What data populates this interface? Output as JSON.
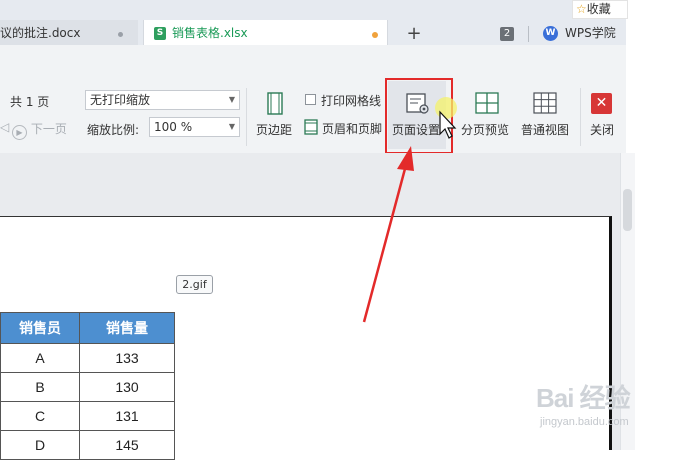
{
  "tabs": [
    {
      "label": "议的批注.docx",
      "type": "docx"
    },
    {
      "label": "销售表格.xlsx",
      "type": "xlsx",
      "active": true
    }
  ],
  "tabbar": {
    "new_tab_glyph": "+",
    "tab_count": "2",
    "wps_logo": "W",
    "wps_label": "WPS学院",
    "favorite_label": "收藏"
  },
  "ribbon": {
    "total_pages": "共 1 页",
    "next_page": "下一页",
    "scale_mode": "无打印缩放",
    "zoom_label": "缩放比例:",
    "zoom_value": "100 %",
    "print_gridlines": "打印网格线",
    "margins": "页边距",
    "header_footer": "页眉和页脚",
    "page_setup": "页面设置",
    "page_break_preview": "分页预览",
    "normal_view": "普通视图",
    "close": "关闭"
  },
  "preview": {
    "image_label": "2.gif",
    "table": {
      "headers": [
        "销售员",
        "销售量"
      ],
      "rows": [
        [
          "A",
          "133"
        ],
        [
          "B",
          "130"
        ],
        [
          "C",
          "131"
        ],
        [
          "D",
          "145"
        ]
      ]
    }
  },
  "watermark": {
    "brand": "Bai  经验",
    "url": "jingyan.baidu.com"
  },
  "colors": {
    "accent_green": "#1a9a57",
    "highlight_red": "#e32a2a",
    "table_header": "#4d8fd0",
    "cursor_glow": "#f4f26a"
  }
}
